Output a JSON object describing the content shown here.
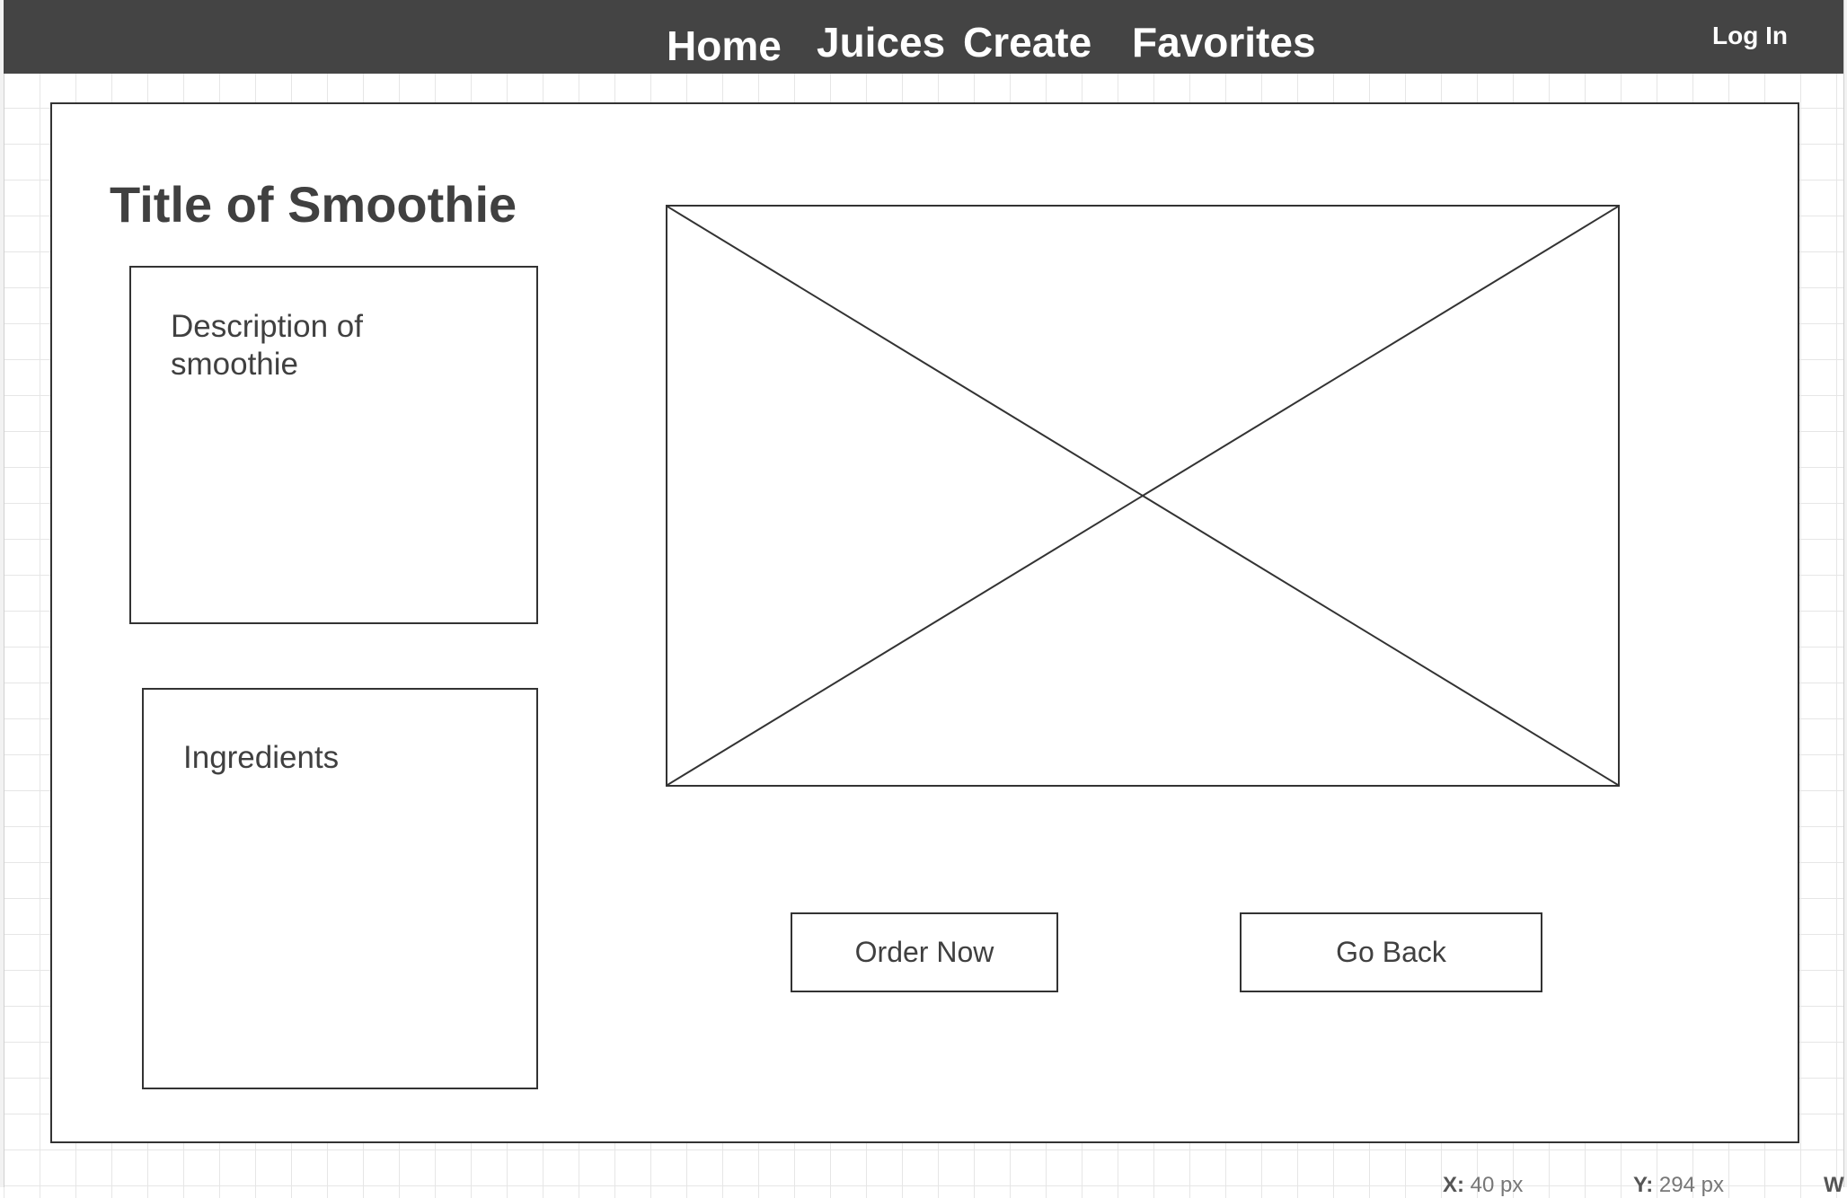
{
  "nav": {
    "home": "Home",
    "juices": "Juices",
    "create": "Create",
    "favorites": "Favorites",
    "login": "Log In"
  },
  "page": {
    "title": "Title of Smoothie",
    "description": "Description of smoothie",
    "ingredients": "Ingredients"
  },
  "image_placeholder": {
    "icon": "image-placeholder-icon"
  },
  "buttons": {
    "order": "Order Now",
    "back": "Go Back"
  },
  "status_bar": {
    "x_label": "X:",
    "x_value": "40 px",
    "y_label": "Y:",
    "y_value": "294 px",
    "w_label": "W"
  },
  "colors": {
    "navbar": "#444444",
    "nav_text": "#ffffff",
    "text": "#404040",
    "border": "#333333"
  }
}
